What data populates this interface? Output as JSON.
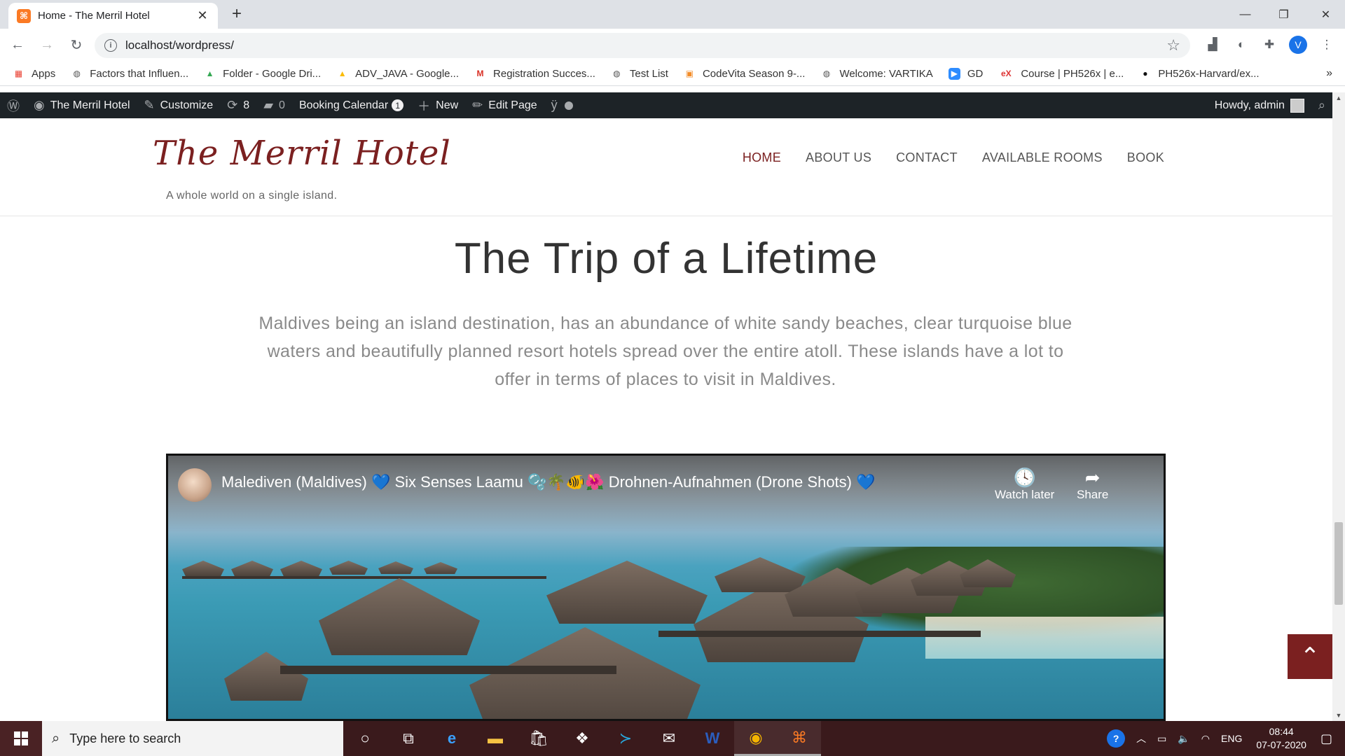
{
  "browser": {
    "tab_title": "Home - The Merril Hotel",
    "url": "localhost/wordpress/",
    "profile_initial": "V",
    "bookmarks": [
      {
        "label": "Apps",
        "icon": "apps-grid-icon"
      },
      {
        "label": "Factors that Influen...",
        "icon": "globe-icon"
      },
      {
        "label": "Folder - Google Dri...",
        "icon": "google-drive-icon"
      },
      {
        "label": "ADV_JAVA - Google...",
        "icon": "google-drive-icon"
      },
      {
        "label": "Registration Succes...",
        "icon": "gmail-icon"
      },
      {
        "label": "Test List",
        "icon": "globe-icon"
      },
      {
        "label": "CodeVita Season 9-...",
        "icon": "codevita-icon"
      },
      {
        "label": "Welcome: VARTIKA",
        "icon": "globe-icon"
      },
      {
        "label": "GD",
        "icon": "zoom-icon"
      },
      {
        "label": "Course | PH526x | e...",
        "icon": "edx-icon"
      },
      {
        "label": "PH526x-Harvard/ex...",
        "icon": "github-icon"
      }
    ],
    "more_bookmarks": "»"
  },
  "adminbar": {
    "site_name": "The Merril Hotel",
    "customize": "Customize",
    "updates_count": "8",
    "comments_count": "0",
    "booking_calendar": "Booking Calendar",
    "booking_badge": "1",
    "new": "New",
    "edit_page": "Edit Page",
    "howdy": "Howdy, admin"
  },
  "site": {
    "title": "The Merril Hotel",
    "tagline": "A whole world on a single island.",
    "nav": [
      "HOME",
      "ABOUT US",
      "CONTACT",
      "AVAILABLE ROOMS",
      "BOOK"
    ]
  },
  "content": {
    "headline": "The Trip of a Lifetime",
    "lead": "Maldives being an island destination, has an abundance of white sandy beaches, clear turquoise blue waters and beautifully planned resort hotels spread over the entire atoll. These islands have a lot to offer in terms of places to visit in Maldives.",
    "video": {
      "title": "Malediven (Maldives) 💙 Six Senses Laamu 🫧🌴🐠🌺 Drohnen-Aufnahmen (Drone Shots) 💙",
      "watch_later": "Watch later",
      "share": "Share"
    }
  },
  "taskbar": {
    "search_placeholder": "Type here to search",
    "language": "ENG",
    "time": "08:44",
    "date": "07-07-2020"
  },
  "colors": {
    "brand": "#7b2020",
    "adminbar": "#1d2327",
    "taskbar": "#3a1a1c"
  }
}
